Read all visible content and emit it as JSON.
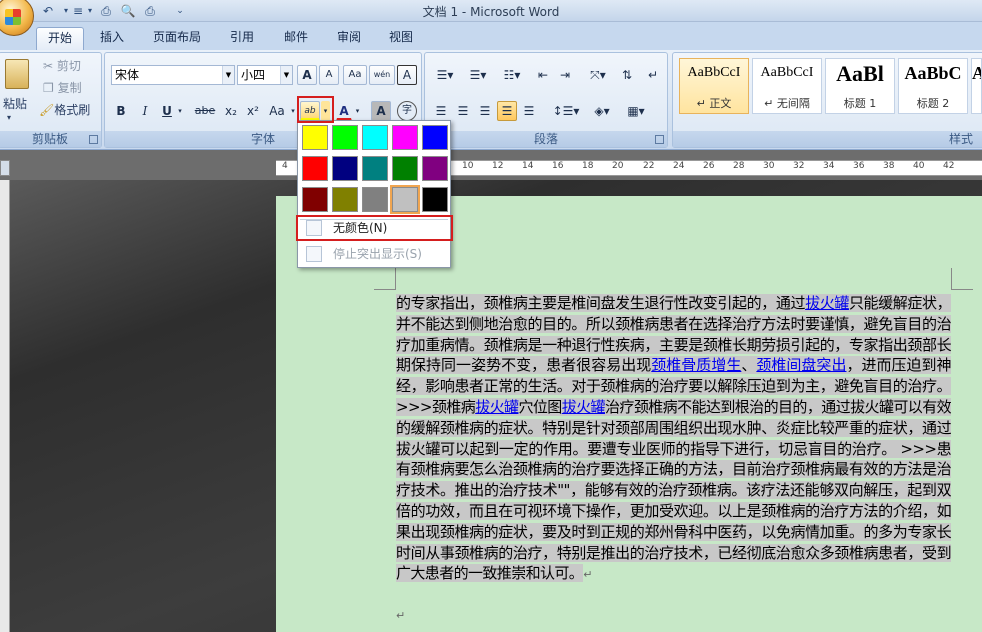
{
  "window": {
    "title": "文档 1 - Microsoft Word"
  },
  "tabs": [
    "开始",
    "插入",
    "页面布局",
    "引用",
    "邮件",
    "审阅",
    "视图"
  ],
  "clipboard": {
    "paste_label": "粘贴",
    "cut_label": "剪切",
    "copy_label": "复制",
    "format_painter_label": "格式刷",
    "group_label": "剪贴板"
  },
  "font": {
    "font_name": "宋体",
    "font_size": "小四",
    "grow_label": "A",
    "shrink_label": "A",
    "clear_label": "Aa",
    "phonetic_label": "wén",
    "border_char_label": "A",
    "bold": "B",
    "italic": "I",
    "underline": "U",
    "strike": "abe",
    "subscript": "x₂",
    "superscript": "x²",
    "case_label": "Aa",
    "highlight_label": "ab",
    "font_color_label": "A",
    "char_shading_label": "A",
    "enclose_label": "字",
    "group_label": "字体"
  },
  "paragraph": {
    "group_label": "段落"
  },
  "styles": {
    "group_label": "样式",
    "items": [
      {
        "sample": "AaBbCcI",
        "name": "↵ 正文"
      },
      {
        "sample": "AaBbCcI",
        "name": "↵ 无间隔"
      },
      {
        "sample": "AaBl",
        "name": "标题 1"
      },
      {
        "sample": "AaBbC",
        "name": "标题 2"
      },
      {
        "sample": "A",
        "name": ""
      }
    ]
  },
  "ruler": {
    "ticks": [
      "4",
      "2",
      "2",
      "4",
      "6",
      "8",
      "10",
      "12",
      "14",
      "16",
      "18",
      "20",
      "22",
      "24",
      "26",
      "28",
      "30",
      "32",
      "34",
      "36",
      "38",
      "40",
      "42"
    ]
  },
  "highlight_popup": {
    "swatch_colors": [
      "#ffff00",
      "#00ff00",
      "#00ffff",
      "#ff00ff",
      "#0000ff",
      "#ff0000",
      "#000080",
      "#008080",
      "#008000",
      "#800080",
      "#800000",
      "#808000",
      "#808080",
      "#c0c0c0",
      "#000000"
    ],
    "selected_swatch": "#c0c0c0",
    "no_color_label": "无颜色(N)",
    "stop_highlight_label": "停止突出显示(S)"
  },
  "document": {
    "segments": [
      {
        "text": "的专家指出，颈椎病主要是椎间盘发生退行性改变引起的，通过",
        "link": false
      },
      {
        "text": "拔火罐",
        "link": true
      },
      {
        "text": "只能缓解症状，并不能达到侧地治愈的目的。所以颈椎病患者在选择治疗方法时要谨慎，避免盲目的治疗加重病情。颈椎病是一种退行性疾病，主要是颈椎长期劳损引起的，专家指出颈部长期保持同一姿势不变，患者很容易出现",
        "link": false
      },
      {
        "text": "颈椎骨质增生",
        "link": true
      },
      {
        "text": "、",
        "link": false
      },
      {
        "text": "颈椎间盘突出",
        "link": true
      },
      {
        "text": "，进而压迫到神经，影响患者正常的生活。对于颈椎病的治疗要以解除压迫到为主，避免盲目的治疗。 >>>颈椎病",
        "link": false
      },
      {
        "text": "拔火罐",
        "link": true
      },
      {
        "text": "穴位图",
        "link": false
      },
      {
        "text": "拔火罐",
        "link": true
      },
      {
        "text": "治疗颈椎病不能达到根治的目的，通过拔火罐可以有效的缓解颈椎病的症状。特别是针对颈部周围组织出现水肿、炎症比较严重的症状，通过拔火罐可以起到一定的作用。要遭专业医师的指导下进行，切忌盲目的治疗。 >>>患有颈椎病要怎么治颈椎病的治疗要选择正确的方法，目前治疗颈椎病最有效的方法是治疗技术。推出的治疗技术\"\"，能够有效的治疗颈椎病。该疗法还能够双向解压，起到双倍的功效，而且在可视环境下操作，更加受欢迎。以上是颈椎病的治疗方法的介绍，如果出现颈椎病的症状，要及时到正规的郑州骨科中医药，以免病情加重。的多为专家长时间从事颈椎病的治疗，特别是推出的治疗技术，已经彻底治愈众多颈椎病患者，受到广大患者的一致推崇和认可。",
        "link": false
      }
    ],
    "paragraph_mark": "↵"
  }
}
